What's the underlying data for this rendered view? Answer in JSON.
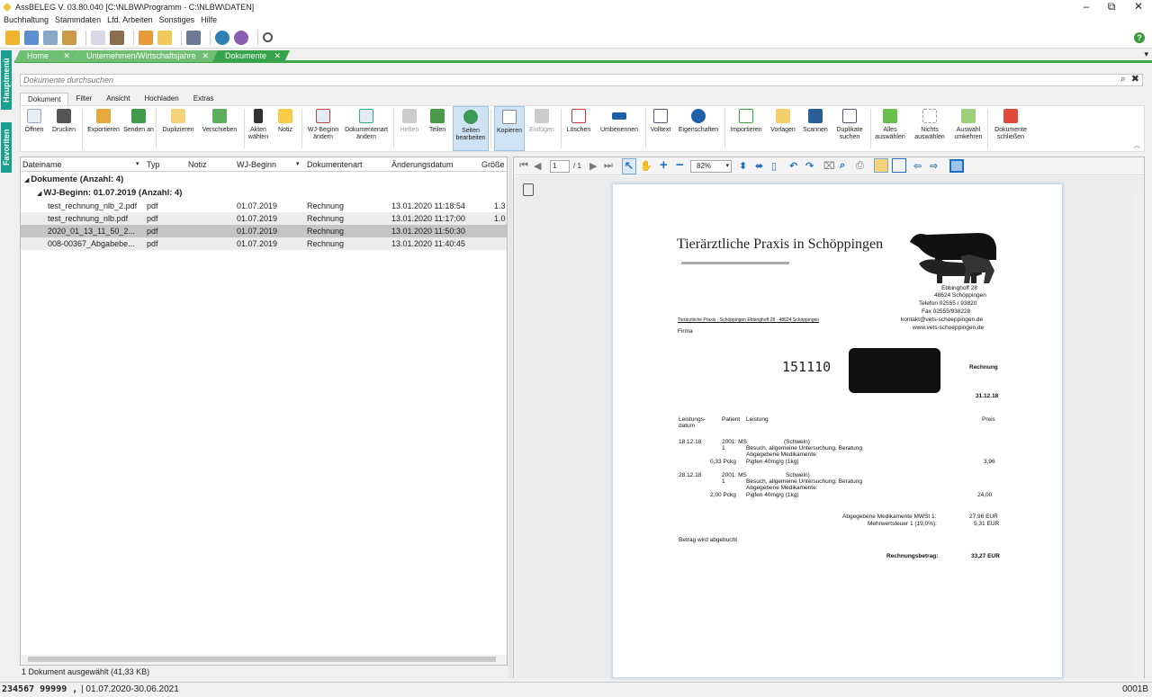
{
  "window": {
    "title": "AssBELEG V. 03.80.040 [C:\\NLBW\\Programm - C:\\NLBW\\DATEN]",
    "minimize": "–",
    "restore": "⧉",
    "close": "✕"
  },
  "menu": [
    "Buchhaltung",
    "Stammdaten",
    "Lfd. Arbeiten",
    "Sonstiges",
    "Hilfe"
  ],
  "help_icon": "?",
  "side_tabs": {
    "main": "Hauptmenü",
    "favorites": "Favoriten"
  },
  "doc_tabs": [
    {
      "label": "Home",
      "close": "✕"
    },
    {
      "label": "Unternehmen/Wirtschaftsjahre",
      "close": "✕"
    },
    {
      "label": "Dokumente",
      "close": "✕"
    }
  ],
  "search": {
    "placeholder": "Dokumente durchsuchen",
    "search_icon": "⌕",
    "clear_icon": "✖"
  },
  "ribbon_tabs": [
    "Dokument",
    "Filter",
    "Ansicht",
    "Hochladen",
    "Extras"
  ],
  "ribbon": {
    "oeffnen": "Öffnen",
    "drucken": "Drucken",
    "exportieren": "Exportieren",
    "senden": "Senden an",
    "duplizieren": "Duplizieren",
    "verschieben": "Verschieben",
    "akten": "Akten wählen",
    "notiz": "Notiz",
    "wjbeginn": "WJ-Beginn ändern",
    "dokart": "Dokumentenart ändern",
    "heften": "Heften",
    "teilen": "Teilen",
    "seiten": "Seiten bearbeiten",
    "kopieren": "Kopieren",
    "einfuegen": "Einfügen",
    "loeschen": "Löschen",
    "umbenennen": "Umbenennen",
    "volltext": "Volltext",
    "eigenschaften": "Eigenschaften",
    "importieren": "Importieren",
    "vorlagen": "Vorlagen",
    "scannen": "Scannen",
    "duplikate": "Duplikate suchen",
    "alle": "Alles auswählen",
    "nichts": "Nichts auswählen",
    "auswahl": "Auswahl umkehren",
    "schliessen": "Dokumente schließen"
  },
  "columns": {
    "name": "Dateiname",
    "typ": "Typ",
    "notiz": "Notiz",
    "wj": "WJ-Beginn",
    "art": "Dokumentenart",
    "datum": "Änderungsdatum",
    "groesse": "Größe"
  },
  "groups": {
    "level1": "Dokumente (Anzahl: 4)",
    "level2": "WJ-Beginn: 01.07.2019 (Anzahl: 4)"
  },
  "rows": [
    {
      "name": "test_rechnung_nlb_2.pdf",
      "typ": "pdf",
      "wj": "01.07.2019",
      "art": "Rechnung",
      "datum": "13.01.2020 11:18:54",
      "size": "1.3"
    },
    {
      "name": "test_rechnung_nlb.pdf",
      "typ": "pdf",
      "wj": "01.07.2019",
      "art": "Rechnung",
      "datum": "13.01.2020 11:17:00",
      "size": "1.0"
    },
    {
      "name": "2020_01_13_11_50_2...",
      "typ": "pdf",
      "wj": "01.07.2019",
      "art": "Rechnung",
      "datum": "13.01.2020 11:50:30",
      "size": ""
    },
    {
      "name": "008-00367_Abgabebe...",
      "typ": "pdf",
      "wj": "01.07.2019",
      "art": "Rechnung",
      "datum": "13.01.2020 11:40:45",
      "size": ""
    }
  ],
  "status": "1 Dokument ausgewählt (41,33 KB)",
  "viewer": {
    "page": "1",
    "of": "/ 1",
    "zoom": "82%"
  },
  "invoice": {
    "title": "Tierärztliche Praxis in Schöppingen",
    "addr1": "Ebbinghoff 28",
    "addr2": "48624 Schöppingen",
    "tel": "Telefon     02555 / 93820",
    "fax": "Fax         02555/938228",
    "mail": "kontakt@vets-schoeppingen.de",
    "web": "www.vets-schoeppingen.de",
    "sender": "Tierärztliche Praxis · Schöppingen Ebbinghoff 28 · 48624 Schöppingen",
    "firma": "Firma",
    "number": "151110",
    "rechnung": "Rechnung",
    "date": "31.12.18",
    "h_leist": "Leistungs-",
    "h_datum": "datum",
    "h_patient": "Patient",
    "h_leistung": "Leistung",
    "h_preis": "Preis",
    "d1": "18.12.18",
    "p1": "2001: MS",
    "s1": "(Schwein)",
    "n1": "1",
    "l1": "Besuch, allgemeine Untersuchung, Beratung",
    "m1": "Abgegebene Medikamente:",
    "q1": "0,33  Pckg",
    "i1": "Pigfen 40mg/g (1kg)",
    "v1": "3,96",
    "d2": "28.12.18",
    "p2": "2001: MS",
    "s2": "Schwein)",
    "n2": "1",
    "l2": "Besuch, allgemeine Untersuchung, Beratung",
    "m2": "Abgegebene Medikamente:",
    "q2": "2,00  Pckg",
    "i2": "Pigfen 40mg/g (1kg)",
    "v2": "24,00",
    "sum1": "Abgegebene Medikamente MWSt 1:",
    "sum1v": "27,96 EUR",
    "sum2": "Mehrwertsteuer 1 (19,0%):",
    "sum2v": "5,31 EUR",
    "abgebucht": "Betrag wird abgebucht",
    "total": "Rechnungsbetrag:",
    "totalv": "33,27 EUR"
  },
  "bottom": {
    "left": "234567 99999 ,",
    "period": "| 01.07.2020-30.06.2021",
    "right": "0001B"
  }
}
